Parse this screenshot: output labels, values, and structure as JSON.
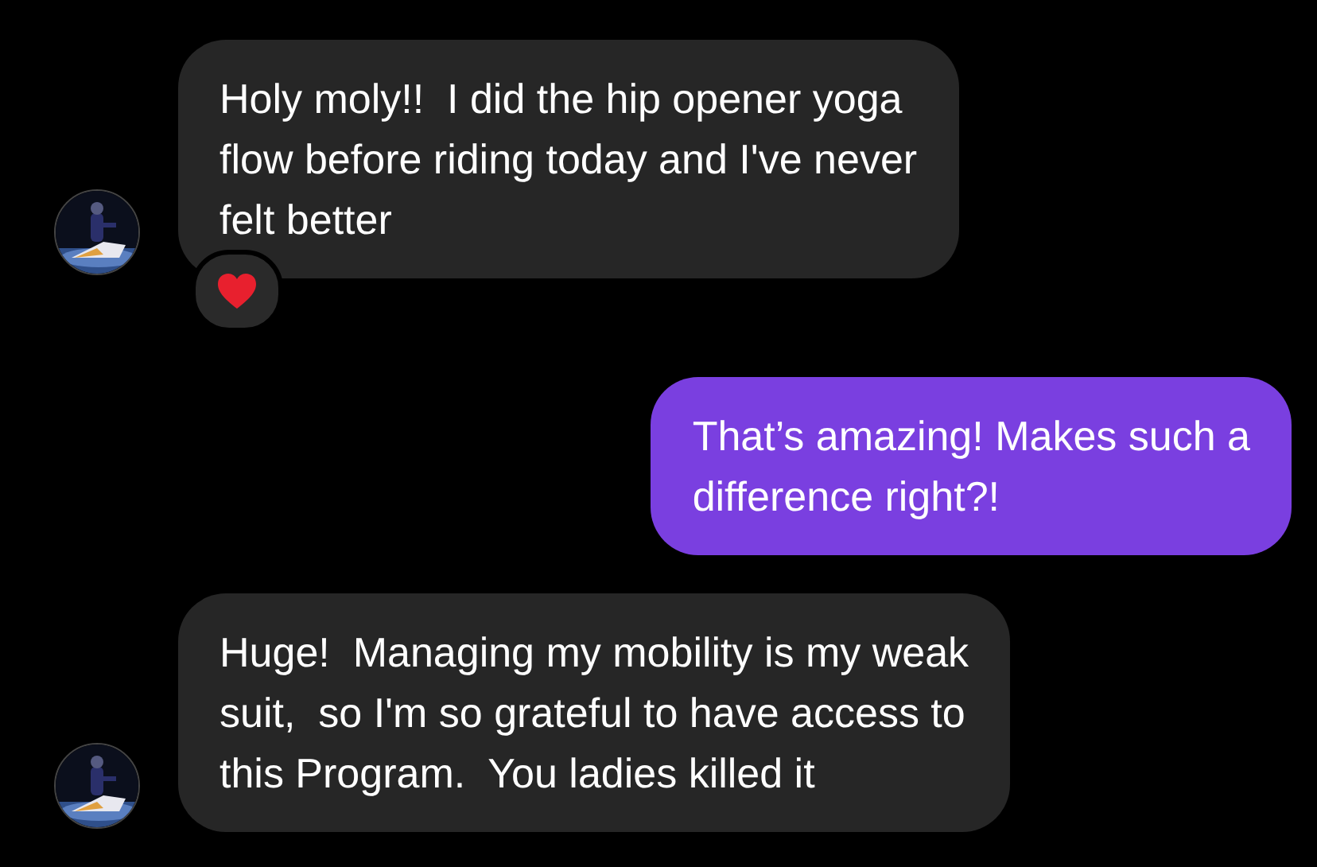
{
  "messages": [
    {
      "kind": "received",
      "lines": [
        "Holy moly!!  I did the hip opener yoga",
        "flow before riding today and I've never",
        "felt better"
      ],
      "hearted": true
    },
    {
      "kind": "sent",
      "lines": [
        "That’s amazing! Makes such a",
        "difference right?!"
      ],
      "hearted": false
    },
    {
      "kind": "received",
      "lines": [
        "Huge!  Managing my mobility is my weak",
        "suit,  so I'm so grateful to have access to",
        "this Program.  You ladies killed it"
      ],
      "hearted": false
    }
  ]
}
